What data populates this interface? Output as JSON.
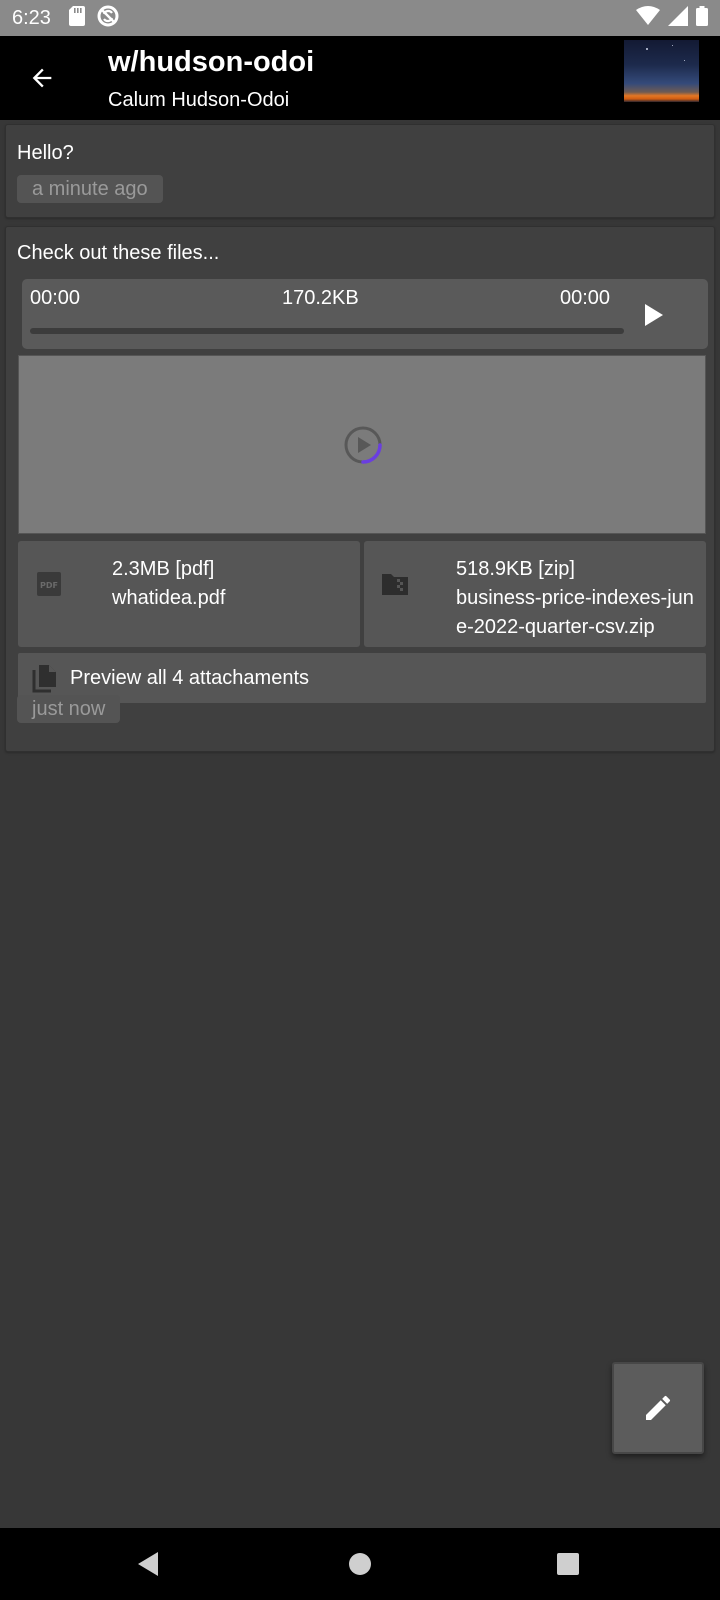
{
  "status_bar": {
    "time": "6:23",
    "icons": [
      "sd-card-icon",
      "sync-blocked-icon",
      "wifi-icon",
      "signal-icon",
      "battery-icon"
    ]
  },
  "app_bar": {
    "title": "w/hudson-odoi",
    "subtitle": "Calum Hudson-Odoi"
  },
  "messages": [
    {
      "text": "Hello?",
      "time": "a minute ago"
    },
    {
      "text": "Check out these files...",
      "time": "just now",
      "audio": {
        "position": "00:00",
        "size": "170.2KB",
        "duration": "00:00",
        "progress": 0.0
      },
      "video": {
        "icon": "play-circle-icon",
        "loading_color": "#6a3ee0"
      },
      "files": [
        {
          "size_type": "2.3MB [pdf]",
          "name": "whatidea.pdf",
          "icon": "pdf-icon"
        },
        {
          "size_type": "518.9KB [zip]",
          "name": "business-price-indexes-june-2022-quarter-csv.zip",
          "icon": "zip-folder-icon"
        }
      ],
      "preview_all_label": "Preview all 4 attachaments"
    }
  ],
  "fab": {
    "icon": "pencil-icon"
  },
  "nav_bar": {
    "icons": [
      "nav-back-icon",
      "nav-home-icon",
      "nav-recents-icon"
    ]
  },
  "colors": {
    "background": "#373737",
    "card": "#404040",
    "app_bar": "#000000",
    "status_bar": "#8a8a8a",
    "accent": "#6a3ee0"
  }
}
